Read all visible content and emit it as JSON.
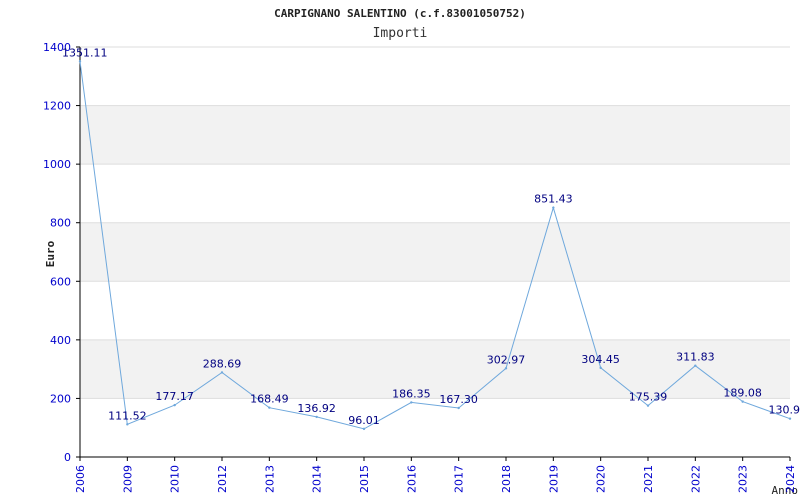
{
  "chart_data": {
    "type": "line",
    "title": "CARPIGNANO SALENTINO (c.f.83001050752)",
    "subtitle": "Importi",
    "xlabel": "Anno",
    "ylabel": "Euro",
    "ylim": [
      0,
      1400
    ],
    "yticks": [
      0,
      200,
      400,
      600,
      800,
      1000,
      1200,
      1400
    ],
    "grid": "horizontal alternating bands",
    "categories": [
      "2006",
      "2009",
      "2010",
      "2012",
      "2013",
      "2014",
      "2015",
      "2016",
      "2017",
      "2018",
      "2019",
      "2020",
      "2021",
      "2022",
      "2023",
      "2024"
    ],
    "values": [
      1351.11,
      111.52,
      177.17,
      288.69,
      168.49,
      136.92,
      96.01,
      186.35,
      167.3,
      302.97,
      851.43,
      304.45,
      175.39,
      311.83,
      189.08,
      130.9
    ],
    "value_labels": [
      "1351.11",
      "111.52",
      "177.17",
      "288.69",
      "168.49",
      "136.92",
      "96.01",
      "186.35",
      "167.30",
      "302.97",
      "851.43",
      "304.45",
      "175.39",
      "311.83",
      "189.08",
      "130.9"
    ],
    "colors": {
      "line": "#6fa8dc",
      "band": "#f2f2f2",
      "axis": "#000000",
      "tick_text": "#0000cc",
      "label_text": "#000080"
    }
  }
}
